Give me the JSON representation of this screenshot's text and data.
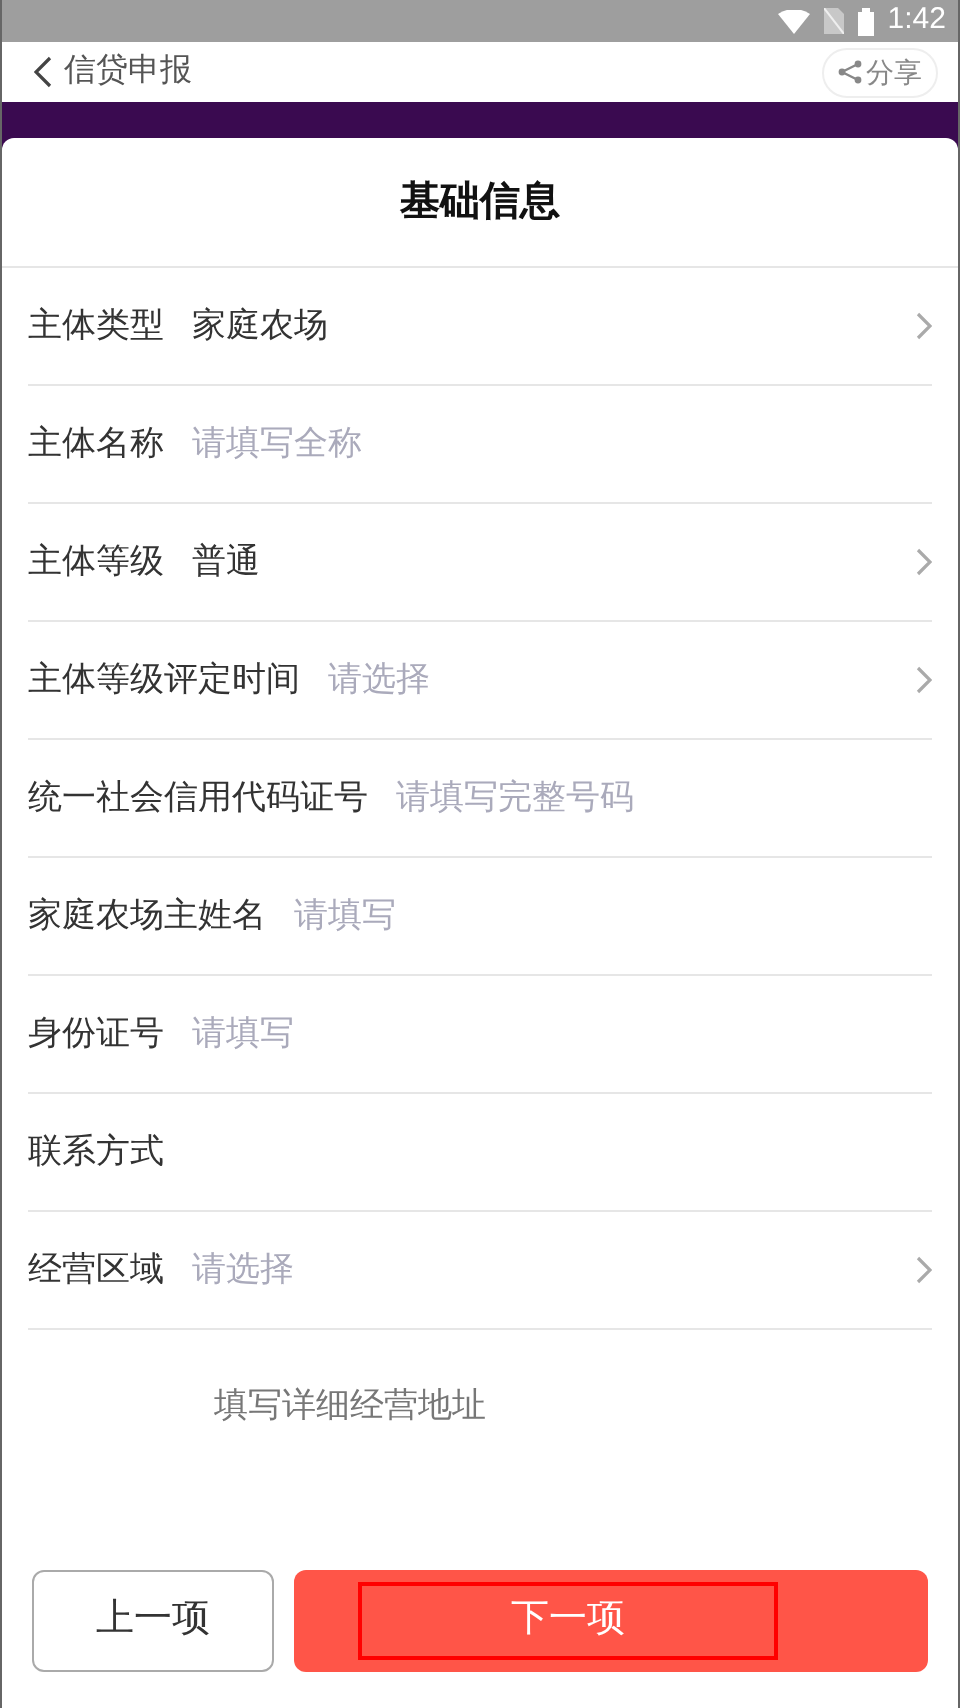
{
  "status_bar": {
    "time": "1:42"
  },
  "header": {
    "back_label": "信贷申报",
    "share_label": "分享"
  },
  "form": {
    "title": "基础信息",
    "fields": [
      {
        "kind": "select",
        "label": "主体类型",
        "value": "家庭农场"
      },
      {
        "kind": "input",
        "label": "主体名称",
        "placeholder": "请填写全称"
      },
      {
        "kind": "select",
        "label": "主体等级",
        "value": "普通"
      },
      {
        "kind": "select",
        "label": "主体等级评定时间",
        "placeholder": "请选择"
      },
      {
        "kind": "input",
        "label": "统一社会信用代码证号",
        "placeholder": "请填写完整号码"
      },
      {
        "kind": "input",
        "label": "家庭农场主姓名",
        "placeholder": "请填写"
      },
      {
        "kind": "input",
        "label": "身份证号",
        "placeholder": "请填写"
      },
      {
        "kind": "input",
        "label": "联系方式"
      },
      {
        "kind": "select",
        "label": "经营区域",
        "placeholder": "请选择"
      }
    ],
    "address": {
      "placeholder": "填写详细经营地址"
    }
  },
  "buttons": {
    "previous": "上一项",
    "next": {
      "label": "下一项",
      "highlighted": true
    }
  }
}
